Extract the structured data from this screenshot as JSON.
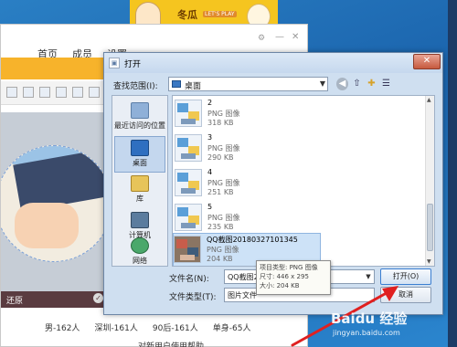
{
  "banner": {
    "text": "冬瓜",
    "sub": "LET'S PLAY"
  },
  "bg_window": {
    "tabs": [
      "首页",
      "成员",
      "设置"
    ],
    "darkbar_label": "还原",
    "tags": [
      "男-162人",
      "深圳-161人",
      "90后-161人",
      "单身-65人"
    ],
    "strip": "对新用户使用帮助"
  },
  "dialog": {
    "title": "打开",
    "lookin_label": "查找范围(I):",
    "lookin_value": "桌面",
    "close": "✕",
    "places": [
      {
        "label": "最近访问的位置",
        "icon": "recent-places-icon"
      },
      {
        "label": "桌面",
        "icon": "desktop-icon"
      },
      {
        "label": "库",
        "icon": "library-icon"
      },
      {
        "label": "计算机",
        "icon": "computer-icon"
      },
      {
        "label": "网络",
        "icon": "network-icon"
      }
    ],
    "files": [
      {
        "name": "2",
        "type": "PNG 图像",
        "size": "318 KB"
      },
      {
        "name": "3",
        "type": "PNG 图像",
        "size": "290 KB"
      },
      {
        "name": "4",
        "type": "PNG 图像",
        "size": "251 KB"
      },
      {
        "name": "5",
        "type": "PNG 图像",
        "size": "235 KB"
      },
      {
        "name": "QQ截图20180327101345",
        "type": "PNG 图像",
        "size": "204 KB"
      }
    ],
    "filename_label": "文件名(N):",
    "filename_value": "QQ截图20",
    "filetype_label": "文件类型(T):",
    "filetype_value": "图片文件",
    "open_button": "打开(O)",
    "cancel_button": "取消",
    "tooltip": {
      "line1": "项目类型: PNG 图像",
      "line2": "尺寸: 446 x 295",
      "line3": "大小: 204 KB"
    }
  },
  "watermark": {
    "main": "Baidu 经验",
    "sub": "jingyan.baidu.com"
  },
  "colors": {
    "dialog_frame": "#cfdff0",
    "selection": "#cde2f7",
    "arrow": "#e02020",
    "close": "#c65a3e"
  }
}
